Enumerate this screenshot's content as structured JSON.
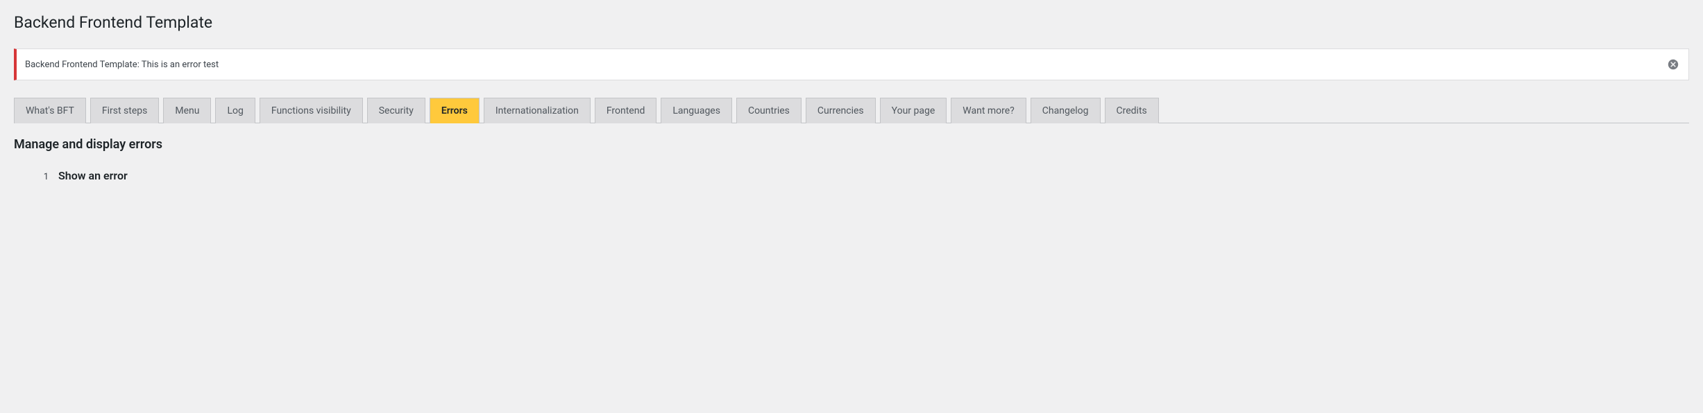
{
  "page": {
    "title": "Backend Frontend Template"
  },
  "notice": {
    "text": "Backend Frontend Template: This is an error test"
  },
  "tabs": [
    {
      "label": "What's BFT",
      "active": false
    },
    {
      "label": "First steps",
      "active": false
    },
    {
      "label": "Menu",
      "active": false
    },
    {
      "label": "Log",
      "active": false
    },
    {
      "label": "Functions visibility",
      "active": false
    },
    {
      "label": "Security",
      "active": false
    },
    {
      "label": "Errors",
      "active": true
    },
    {
      "label": "Internationalization",
      "active": false
    },
    {
      "label": "Frontend",
      "active": false
    },
    {
      "label": "Languages",
      "active": false
    },
    {
      "label": "Countries",
      "active": false
    },
    {
      "label": "Currencies",
      "active": false
    },
    {
      "label": "Your page",
      "active": false
    },
    {
      "label": "Want more?",
      "active": false
    },
    {
      "label": "Changelog",
      "active": false
    },
    {
      "label": "Credits",
      "active": false
    }
  ],
  "section": {
    "title": "Manage and display errors"
  },
  "list": {
    "items": [
      {
        "number": "1",
        "text": "Show an error"
      }
    ]
  }
}
